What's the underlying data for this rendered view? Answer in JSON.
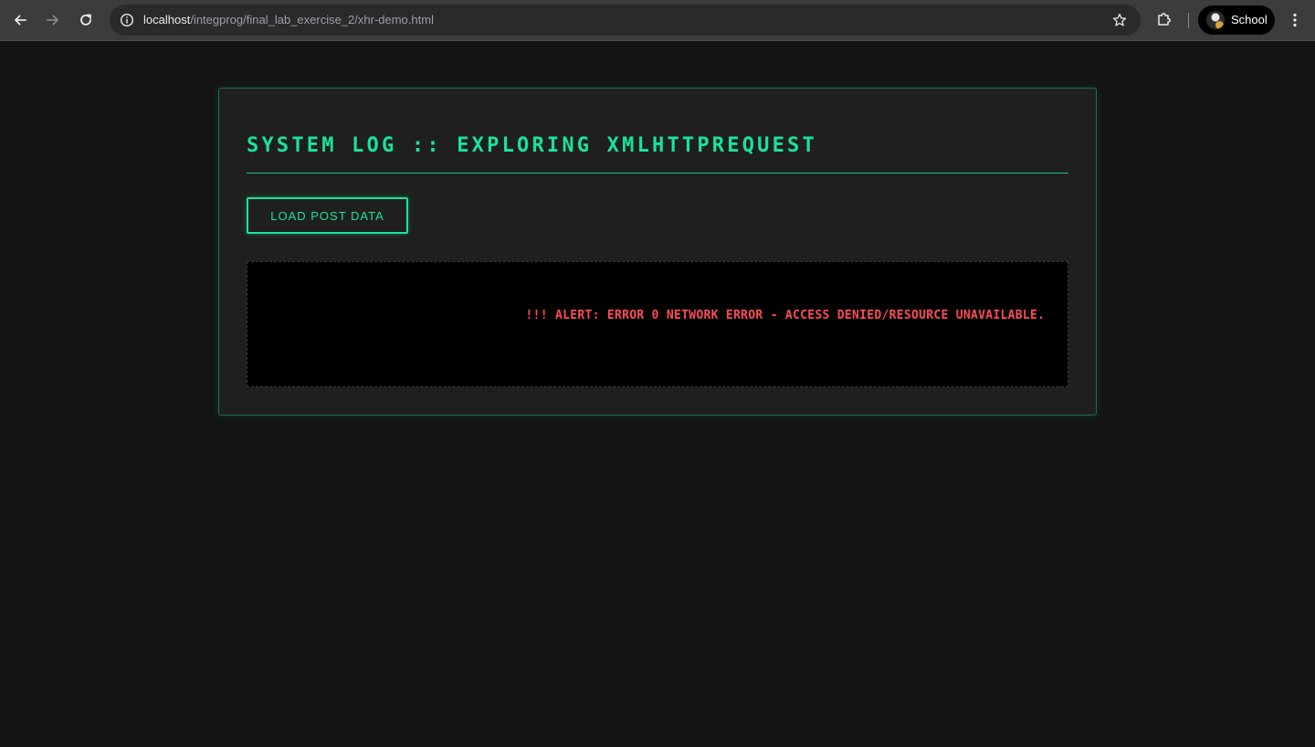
{
  "browser": {
    "url_host": "localhost",
    "url_path": "/integprog/final_lab_exercise_2/xhr-demo.html",
    "profile_name": "School",
    "icons": [
      "back-icon",
      "forward-icon",
      "reload-icon",
      "site-info-icon",
      "star-icon",
      "extensions-icon",
      "menu-icon"
    ]
  },
  "page": {
    "title": "SYSTEM LOG :: EXPLORING XMLHTTPREQUEST",
    "load_button_label": "LOAD POST DATA",
    "output_message": "                                   !!! ALERT: ERROR 0 NETWORK ERROR - ACCESS DENIED/RESOURCE UNAVAILABLE."
  },
  "colors": {
    "accent": "#19e39a",
    "error": "#ff4d55",
    "background": "#141414",
    "panel": "#1f1f1f"
  }
}
